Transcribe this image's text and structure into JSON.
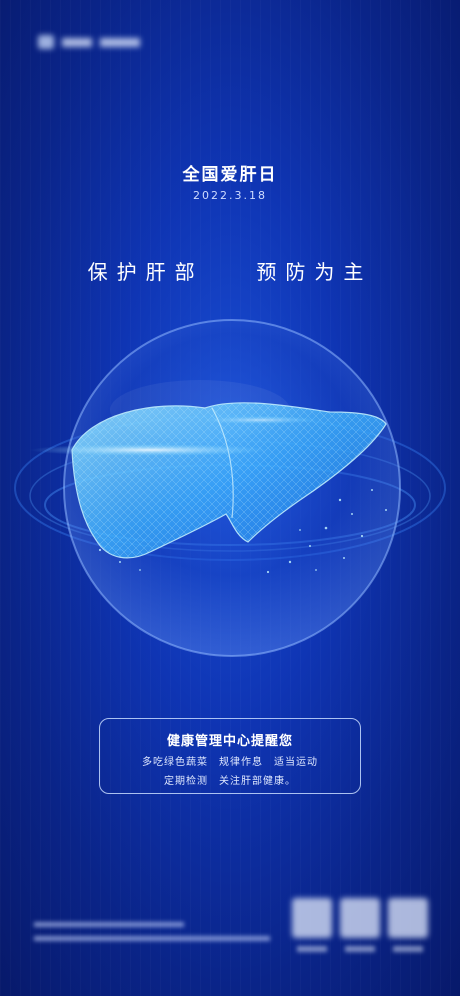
{
  "poster": {
    "title": "全国爱肝日",
    "date": "2022.3.18",
    "slogan_part1": "保护肝部",
    "slogan_part2": "预防为主"
  },
  "card": {
    "heading": "健康管理中心提醒您",
    "line1": "多吃绿色蔬菜　规律作息　适当运动",
    "line2": "定期检测　关注肝部健康。"
  },
  "colors": {
    "background": "#0f35b4",
    "accent": "#58c8ff"
  },
  "icons": [
    "liver-illustration-icon",
    "brand-logo-icon",
    "qr-code-icon"
  ]
}
